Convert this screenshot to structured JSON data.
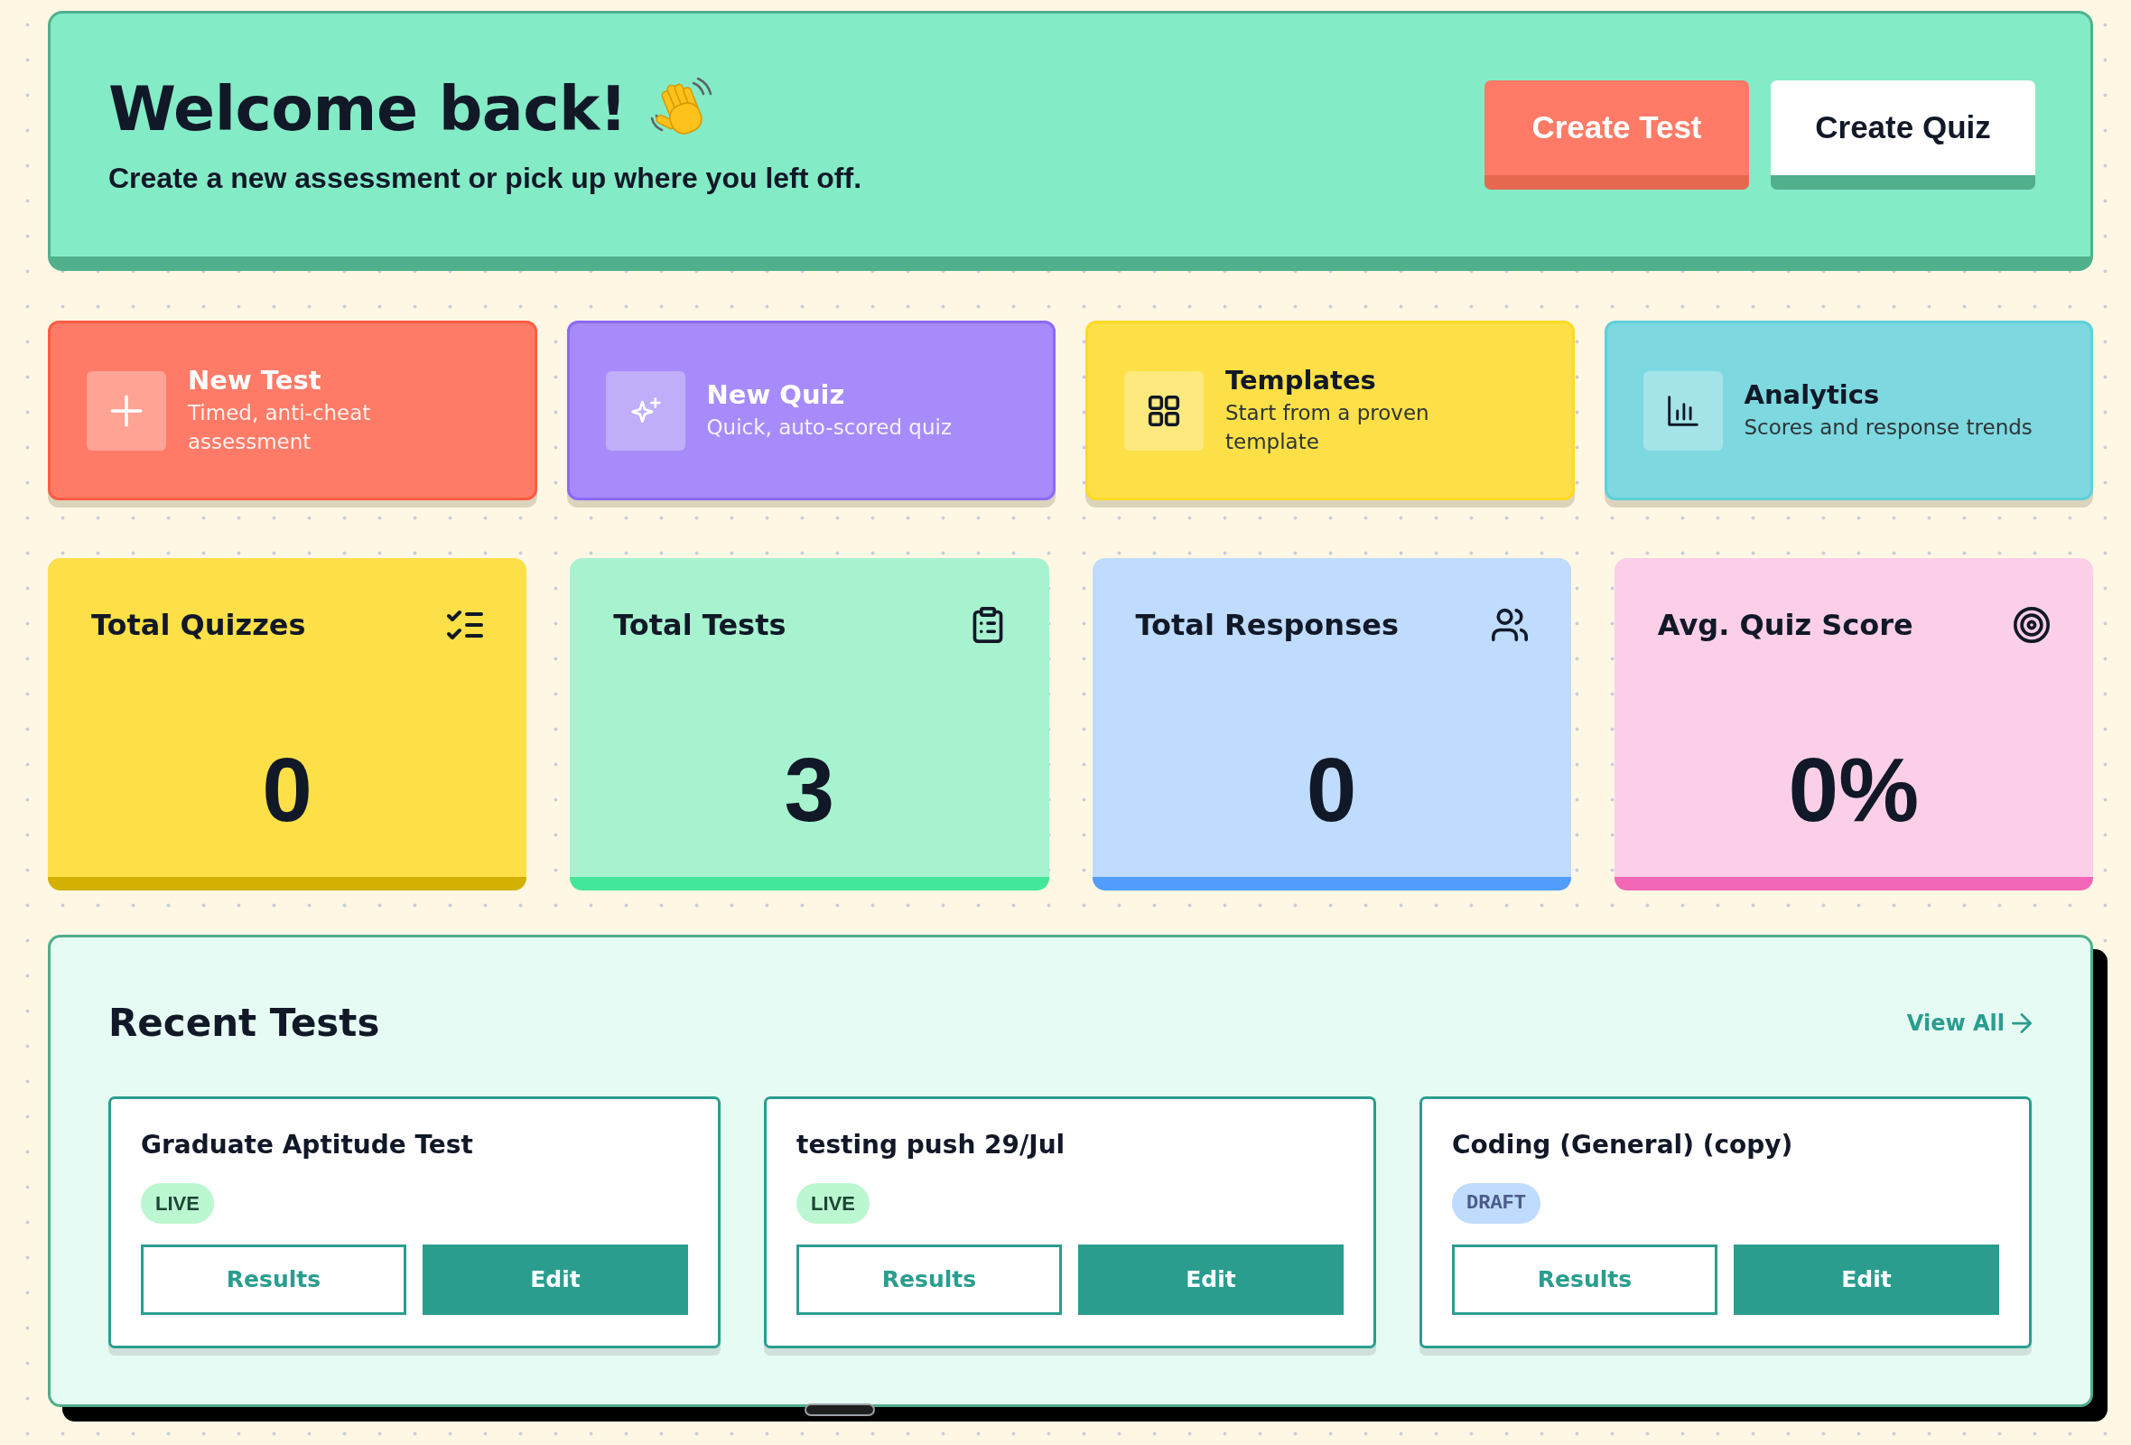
{
  "hero": {
    "title": "Welcome back!",
    "subtitle": "Create a new assessment or pick up where you left off.",
    "buttons": [
      {
        "label": "Create Test",
        "kind": "primary"
      },
      {
        "label": "Create Quiz",
        "kind": "secondary"
      }
    ]
  },
  "quick_actions": [
    {
      "title": "New Test",
      "subtitle": "Timed, anti-cheat assessment",
      "color": "#ff7b67"
    },
    {
      "title": "New Quiz",
      "subtitle": "Quick, auto-scored quiz",
      "color": "#a78bfa"
    },
    {
      "title": "Templates",
      "subtitle": "Start from a proven template",
      "color": "#fde047"
    },
    {
      "title": "Analytics",
      "subtitle": "Scores and response trends",
      "color": "#7dd8e0"
    }
  ],
  "stats": [
    {
      "label": "Total Quizzes",
      "value": "0",
      "color": "#fde047"
    },
    {
      "label": "Total Tests",
      "value": "3",
      "color": "#a7f3d0"
    },
    {
      "label": "Total Responses",
      "value": "0",
      "color": "#bfdbfe"
    },
    {
      "label": "Avg. Quiz Score",
      "value": "0%",
      "color": "#fbcfe8"
    }
  ],
  "recent_tests": {
    "title": "Recent Tests",
    "view_all": "View All",
    "items": [
      {
        "title": "Graduate Aptitude Test",
        "status": {
          "kind": "live",
          "label": "LIVE"
        },
        "actions": [
          {
            "label": "Results",
            "kind": "outline"
          },
          {
            "label": "Edit",
            "kind": "solid"
          }
        ]
      },
      {
        "title": "testing push 29/Jul",
        "status": {
          "kind": "live",
          "label": "LIVE"
        },
        "actions": [
          {
            "label": "Results",
            "kind": "outline"
          },
          {
            "label": "Edit",
            "kind": "solid"
          }
        ]
      },
      {
        "title": "Coding (General) (copy)",
        "status": {
          "kind": "draft",
          "label": "DRAFT"
        },
        "actions": [
          {
            "label": "Results",
            "kind": "outline"
          },
          {
            "label": "Edit",
            "kind": "solid"
          }
        ]
      }
    ]
  }
}
